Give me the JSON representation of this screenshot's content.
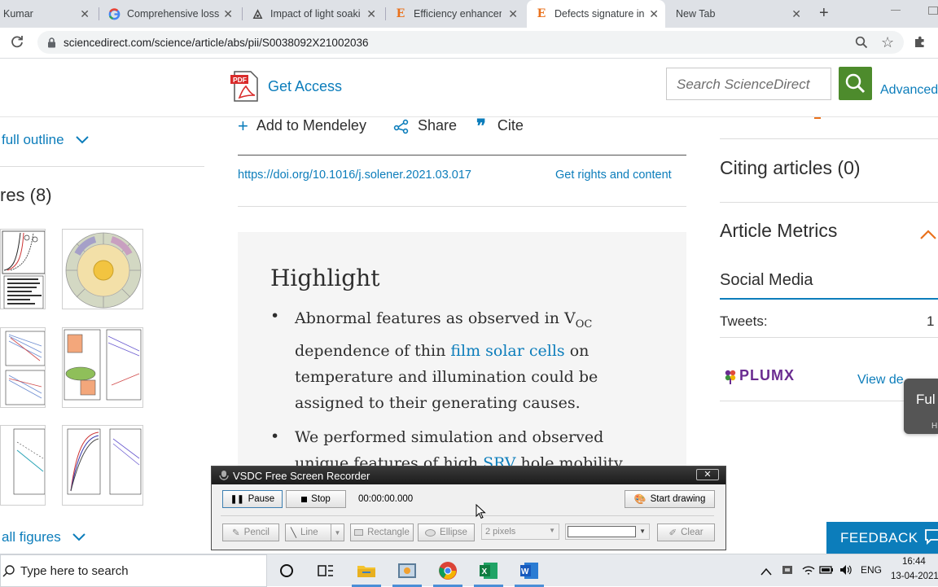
{
  "browser": {
    "tabs": [
      {
        "title": "Kumar",
        "favicon": "person-icon"
      },
      {
        "title": "Comprehensive loss",
        "favicon": "google-icon"
      },
      {
        "title": "Impact of light soaki",
        "favicon": "pdf-icon"
      },
      {
        "title": "Efficiency enhancem",
        "favicon": "elsevier-icon"
      },
      {
        "title": "Defects signature in",
        "favicon": "elsevier-icon"
      },
      {
        "title": "New Tab",
        "favicon": ""
      }
    ],
    "url": "sciencedirect.com/science/article/abs/pii/S0038092X21002036"
  },
  "site": {
    "get_access": "Get Access",
    "search_placeholder": "Search ScienceDirect",
    "advanced": "Advanced"
  },
  "sidebar": {
    "outline": "full outline",
    "figures_heading": "res (8)",
    "all_figures": "all figures"
  },
  "article": {
    "add_mendeley": "Add to Mendeley",
    "share": "Share",
    "cite": "Cite",
    "doi": "https://doi.org/10.1016/j.solener.2021.03.017",
    "rights": "Get rights and content",
    "highlight_title": "Highlight",
    "bullet1": {
      "line1_pre": "Abnormal features as observed in V",
      "line1_sub": "OC",
      "line2_pre": "dependence of thin ",
      "line2_link": "film solar cells",
      "line2_post": " on",
      "line3": "temperature and illumination could be",
      "line4": "assigned to their generating causes."
    },
    "bullet2": {
      "line1": "We performed simulation and observed",
      "line2_pre": "unique features of high ",
      "line2_link": "SRV",
      "line2_post": " hole mobility"
    }
  },
  "right_panel": {
    "citing": "Citing articles (0)",
    "metrics": "Article Metrics",
    "social": "Social Media",
    "tweets_label": "Tweets:",
    "tweets_value": "1",
    "plumx": "PLUMX",
    "view_details": "View de",
    "full_tab": "Ful",
    "full_tab_sub": "H",
    "feedback": "FEEDBACK"
  },
  "recorder": {
    "title": "VSDC Free Screen Recorder",
    "pause": "Pause",
    "stop": "Stop",
    "time": "00:00:00.000",
    "start_drawing": "Start drawing",
    "pencil": "Pencil",
    "line": "Line",
    "rectangle": "Rectangle",
    "ellipse": "Ellipse",
    "pixels": "2 pixels",
    "clear": "Clear"
  },
  "taskbar": {
    "search": "Type here to search",
    "lang": "ENG",
    "time": "16:44",
    "date": "13-04-2021"
  },
  "colors": {
    "accent_green": "#4d8b2c",
    "link_blue": "#0c7dbb",
    "feedback_blue": "#0c7dbb"
  }
}
